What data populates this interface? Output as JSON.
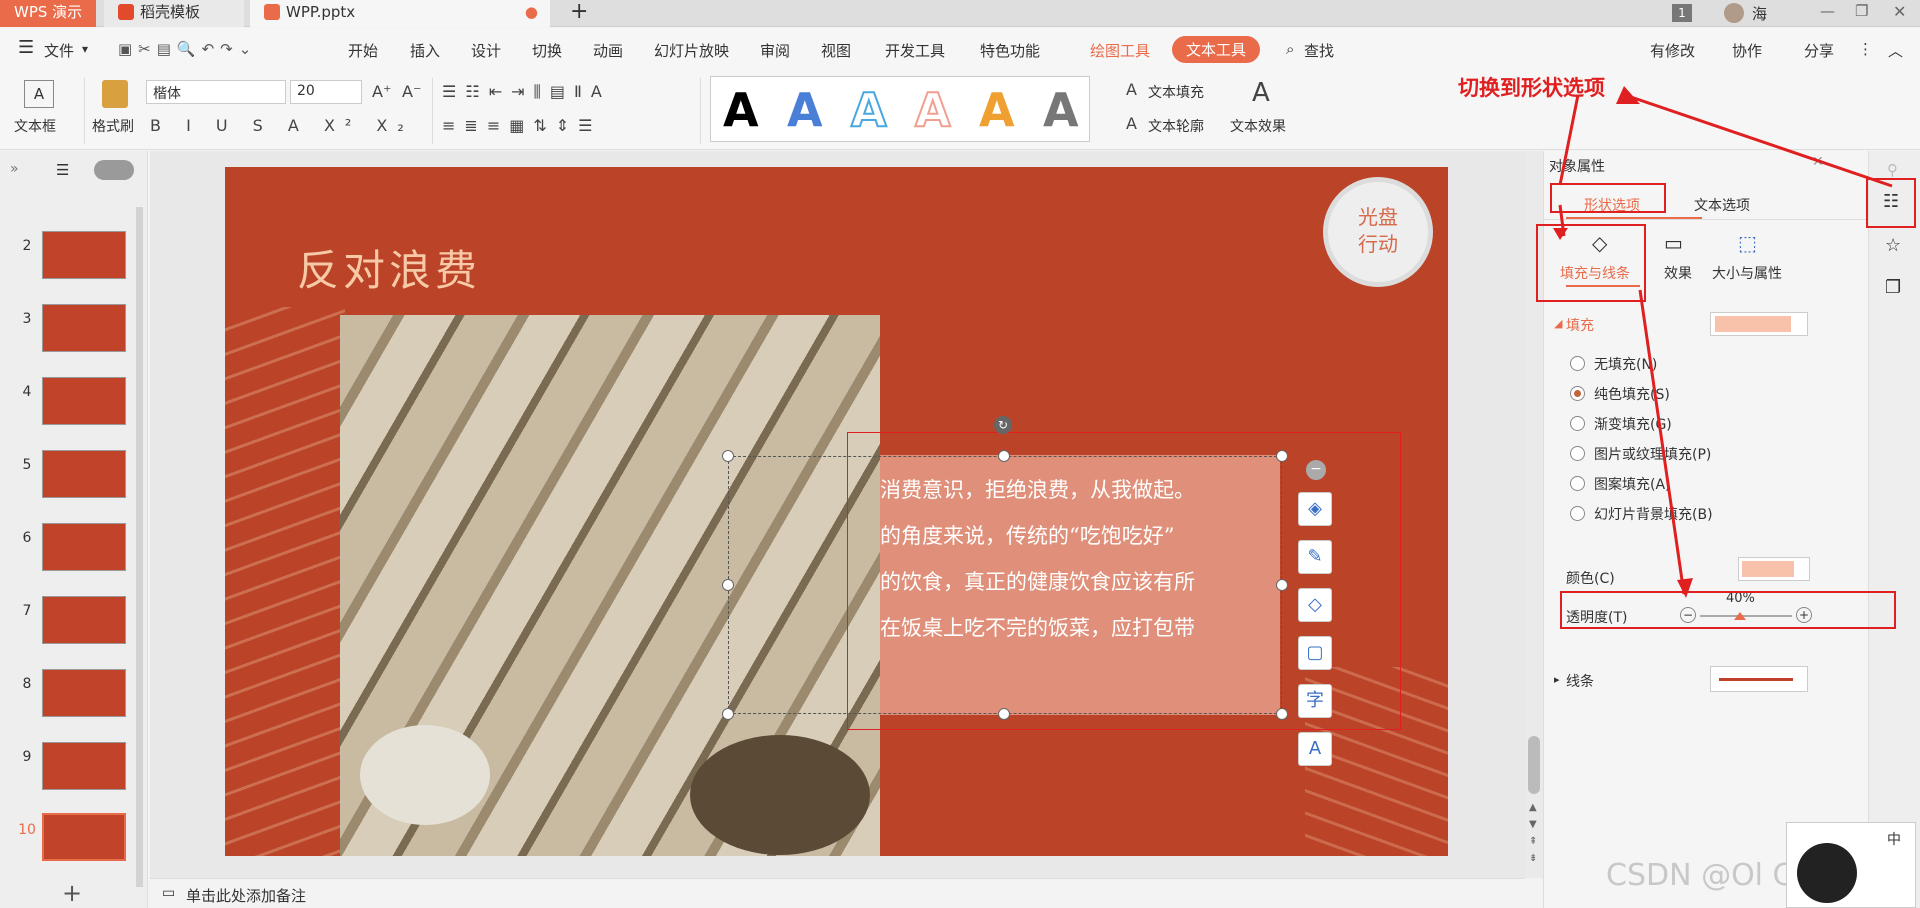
{
  "tabs": {
    "app": "WPS 演示",
    "daoke": "稻壳模板",
    "doc": "WPP.pptx",
    "user": "海",
    "page_badge": "1"
  },
  "menu": {
    "file": "文件",
    "items": [
      "开始",
      "插入",
      "设计",
      "切换",
      "动画",
      "幻灯片放映",
      "审阅",
      "视图",
      "开发工具",
      "特色功能"
    ],
    "drawing_tools": "绘图工具",
    "text_tools": "文本工具",
    "search": "查找",
    "modified": "有修改",
    "collab": "协作",
    "share": "分享"
  },
  "ribbon": {
    "textbox": "文本框",
    "format_painter": "格式刷",
    "font": "楷体",
    "size": "20",
    "text_fill": "文本填充",
    "text_outline": "文本轮廓",
    "text_effect": "文本效果",
    "wordart_letter": "A",
    "wordart_colors": [
      "#000000",
      "#4a7fd8",
      "#4aa7e0",
      "#f0a090",
      "#f0a030",
      "#777777"
    ]
  },
  "left_panel": {
    "slide_numbers": [
      "2",
      "3",
      "4",
      "5",
      "6",
      "7",
      "8",
      "9",
      "10"
    ],
    "active": "10"
  },
  "slide": {
    "title": "反对浪费",
    "badge_line1": "光盘",
    "badge_line2": "行动",
    "text_lines": [
      "消费意识，拒绝浪费，从我做起。",
      "的角度来说，传统的“吃饱吃好”",
      "的饮食，真正的健康饮食应该有所",
      "在饭桌上吃不完的饭菜，应打包带"
    ]
  },
  "notes": {
    "placeholder": "单击此处添加备注"
  },
  "panel": {
    "title": "对象属性",
    "tab_shape": "形状选项",
    "tab_text": "文本选项",
    "sub_fill_line": "填充与线条",
    "sub_effect": "效果",
    "sub_size": "大小与属性",
    "fill_header": "填充",
    "fill_options": [
      "无填充(N)",
      "纯色填充(S)",
      "渐变填充(G)",
      "图片或纹理填充(P)",
      "图案填充(A)",
      "幻灯片背景填充(B)"
    ],
    "color_label": "颜色(C)",
    "transparency_label": "透明度(T)",
    "transparency_value": "40%",
    "line_header": "线条"
  },
  "annotation": {
    "text": "切换到形状选项"
  },
  "watermark": {
    "text": "CSDN @Ol Correct",
    "ime": "中"
  },
  "colors": {
    "accent": "#e96b4a",
    "slide_bg": "#ba4328",
    "fill_color": "#f7c2a9",
    "annotation_red": "#e02020"
  }
}
